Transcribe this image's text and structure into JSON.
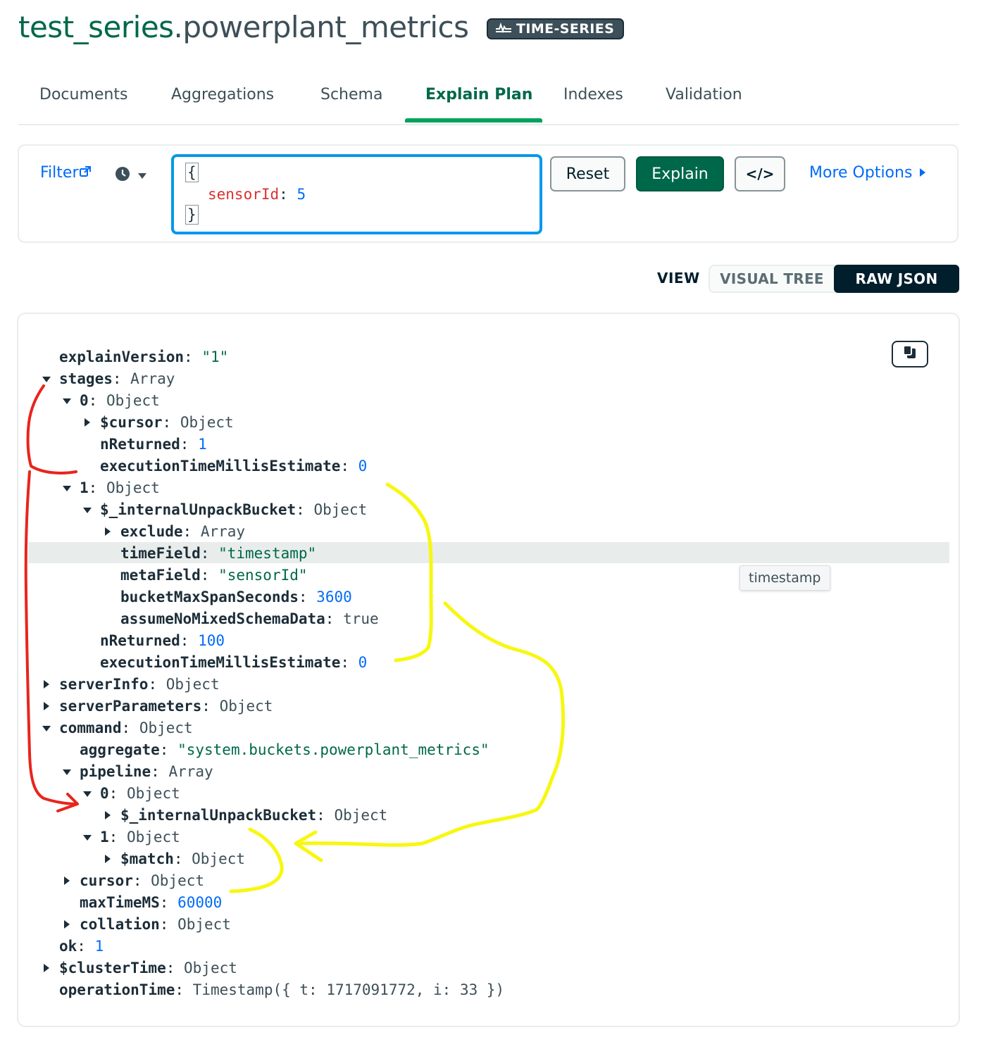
{
  "header": {
    "database": "test_series",
    "collection": ".powerplant_metrics",
    "badge": "TIME-SERIES"
  },
  "tabs": [
    {
      "label": "Documents"
    },
    {
      "label": "Aggregations"
    },
    {
      "label": "Schema"
    },
    {
      "label": "Explain Plan",
      "active": true
    },
    {
      "label": "Indexes"
    },
    {
      "label": "Validation"
    }
  ],
  "filter": {
    "label": "Filter",
    "query_open": "{",
    "query_key": "sensorId",
    "query_value": "5",
    "query_close": "}",
    "reset_label": "Reset",
    "explain_label": "Explain",
    "code_label": "</>",
    "more_options_label": "More Options"
  },
  "view": {
    "label": "VIEW",
    "options": [
      "VISUAL TREE",
      "RAW JSON"
    ],
    "selected": "RAW JSON"
  },
  "tooltip": "timestamp",
  "json_tree": [
    {
      "key": "explainVersion",
      "value": "\"1\"",
      "type": "string",
      "depth": 0,
      "toggle": "none"
    },
    {
      "key": "stages",
      "value": "Array",
      "type": "type",
      "depth": 0,
      "toggle": "down"
    },
    {
      "key": "0",
      "value": "Object",
      "type": "type",
      "depth": 1,
      "toggle": "down"
    },
    {
      "key": "$cursor",
      "value": "Object",
      "type": "type",
      "depth": 2,
      "toggle": "right"
    },
    {
      "key": "nReturned",
      "value": "1",
      "type": "number",
      "depth": 2,
      "toggle": "none"
    },
    {
      "key": "executionTimeMillisEstimate",
      "value": "0",
      "type": "number",
      "depth": 2,
      "toggle": "none"
    },
    {
      "key": "1",
      "value": "Object",
      "type": "type",
      "depth": 1,
      "toggle": "down"
    },
    {
      "key": "$_internalUnpackBucket",
      "value": "Object",
      "type": "type",
      "depth": 2,
      "toggle": "down"
    },
    {
      "key": "exclude",
      "value": "Array",
      "type": "type",
      "depth": 3,
      "toggle": "right"
    },
    {
      "key": "timeField",
      "value": "\"timestamp\"",
      "type": "string",
      "depth": 3,
      "toggle": "none",
      "highlight": true
    },
    {
      "key": "metaField",
      "value": "\"sensorId\"",
      "type": "string",
      "depth": 3,
      "toggle": "none"
    },
    {
      "key": "bucketMaxSpanSeconds",
      "value": "3600",
      "type": "number",
      "depth": 3,
      "toggle": "none"
    },
    {
      "key": "assumeNoMixedSchemaData",
      "value": "true",
      "type": "type",
      "depth": 3,
      "toggle": "none"
    },
    {
      "key": "nReturned",
      "value": "100",
      "type": "number",
      "depth": 2,
      "toggle": "none"
    },
    {
      "key": "executionTimeMillisEstimate",
      "value": "0",
      "type": "number",
      "depth": 2,
      "toggle": "none"
    },
    {
      "key": "serverInfo",
      "value": "Object",
      "type": "type",
      "depth": 0,
      "toggle": "right"
    },
    {
      "key": "serverParameters",
      "value": "Object",
      "type": "type",
      "depth": 0,
      "toggle": "right"
    },
    {
      "key": "command",
      "value": "Object",
      "type": "type",
      "depth": 0,
      "toggle": "down"
    },
    {
      "key": "aggregate",
      "value": "\"system.buckets.powerplant_metrics\"",
      "type": "string",
      "depth": 1,
      "toggle": "none"
    },
    {
      "key": "pipeline",
      "value": "Array",
      "type": "type",
      "depth": 1,
      "toggle": "down"
    },
    {
      "key": "0",
      "value": "Object",
      "type": "type",
      "depth": 2,
      "toggle": "down"
    },
    {
      "key": "$_internalUnpackBucket",
      "value": "Object",
      "type": "type",
      "depth": 3,
      "toggle": "right"
    },
    {
      "key": "1",
      "value": "Object",
      "type": "type",
      "depth": 2,
      "toggle": "down"
    },
    {
      "key": "$match",
      "value": "Object",
      "type": "type",
      "depth": 3,
      "toggle": "right"
    },
    {
      "key": "cursor",
      "value": "Object",
      "type": "type",
      "depth": 1,
      "toggle": "right"
    },
    {
      "key": "maxTimeMS",
      "value": "60000",
      "type": "number",
      "depth": 1,
      "toggle": "none"
    },
    {
      "key": "collation",
      "value": "Object",
      "type": "type",
      "depth": 1,
      "toggle": "right"
    },
    {
      "key": "ok",
      "value": "1",
      "type": "number",
      "depth": 0,
      "toggle": "none"
    },
    {
      "key": "$clusterTime",
      "value": "Object",
      "type": "type",
      "depth": 0,
      "toggle": "right"
    },
    {
      "key": "operationTime",
      "value": "Timestamp({ t: 1717091772, i: 33 })",
      "type": "type",
      "depth": 0,
      "toggle": "none"
    }
  ],
  "colors": {
    "brand_green": "#00684a",
    "active_tab_underline": "#00a35c",
    "link_blue": "#016bf8",
    "query_border": "#0498ec",
    "annotation_red": "#e8251c",
    "annotation_yellow": "#f7f711"
  },
  "icons": [
    "external-link-icon",
    "clock-icon",
    "caret-down-icon",
    "caret-right-icon",
    "time-series-icon",
    "copy-icon"
  ]
}
